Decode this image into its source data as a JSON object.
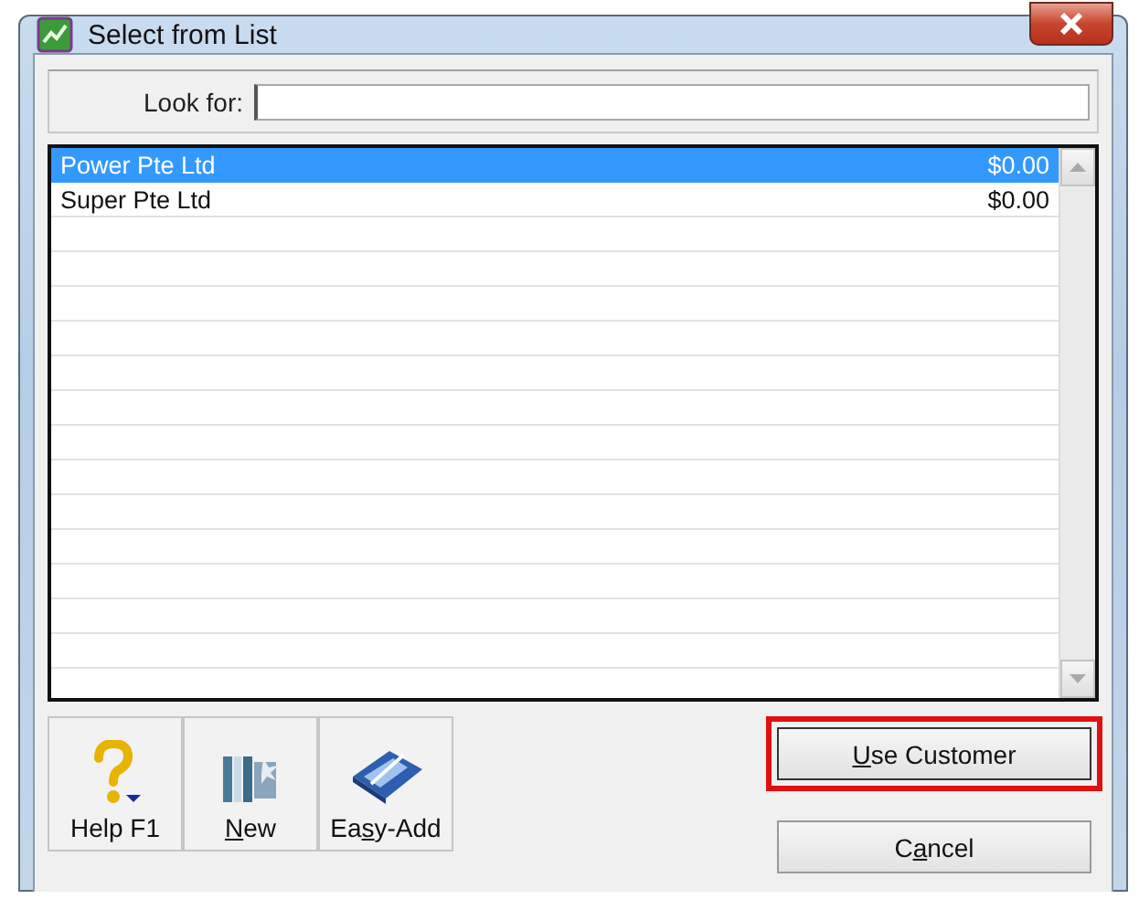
{
  "window": {
    "title": "Select from List"
  },
  "search": {
    "label": "Look for:"
  },
  "list": {
    "rows": [
      {
        "name": "Power Pte Ltd",
        "amount": "$0.00",
        "selected": true
      },
      {
        "name": "Super Pte Ltd",
        "amount": "$0.00",
        "selected": false
      }
    ]
  },
  "toolbar": [
    {
      "kind": "help",
      "label": {
        "before": "Help F1"
      }
    },
    {
      "kind": "new",
      "label": {
        "key": "N",
        "after": "ew"
      }
    },
    {
      "kind": "easyadd",
      "label": {
        "before": "Ea",
        "key": "s",
        "after": "y-Add"
      }
    }
  ],
  "buttons": [
    {
      "label": {
        "key": "U",
        "after": "se Customer"
      },
      "highlighted": true
    },
    {
      "label": {
        "before": "C",
        "key": "a",
        "after": "ncel"
      },
      "highlighted": false
    }
  ]
}
